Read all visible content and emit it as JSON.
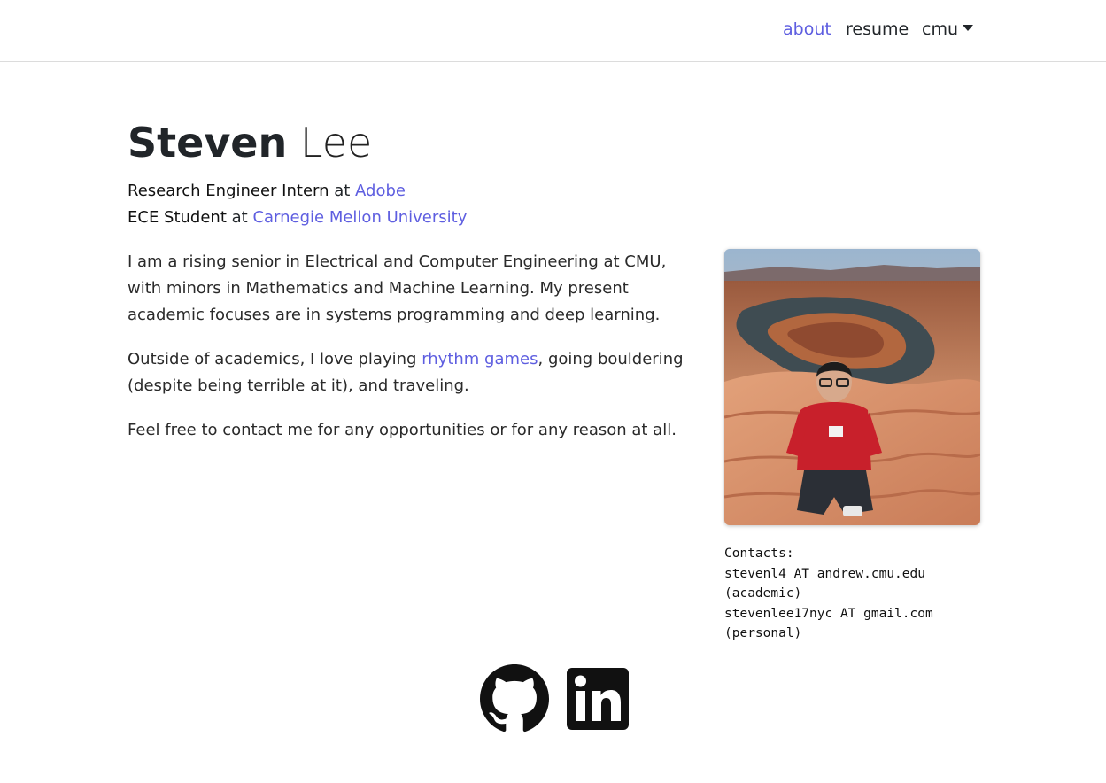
{
  "nav": {
    "items": [
      {
        "label": "about",
        "active": true
      },
      {
        "label": "resume"
      },
      {
        "label": "cmu",
        "dropdown": true
      }
    ]
  },
  "hero": {
    "first_name": "Steven",
    "last_name": " Lee",
    "roles": [
      {
        "title": "Research Engineer Intern",
        "connector": " at ",
        "org": "Adobe"
      },
      {
        "title": "ECE Student",
        "connector": " at ",
        "org": "Carnegie Mellon University"
      }
    ]
  },
  "about": {
    "p1": "I am a rising senior in Electrical and Computer Engineering at CMU, with minors in Mathematics and Machine Learning. My present academic focuses are in systems programming and deep learning.",
    "p2_before": "Outside of academics, I love playing ",
    "p2_link": "rhythm games",
    "p2_after": ", going bouldering (despite being terrible at it), and traveling.",
    "p3": "Feel free to contact me for any opportunities or for any reason at all."
  },
  "contacts": {
    "heading": "Contacts:",
    "academic": "stevenl4 AT andrew.cmu.edu",
    "academic_note": "(academic)",
    "personal": "stevenlee17nyc AT gmail.com",
    "personal_note": "(personal)"
  },
  "social": {
    "github_icon": "github-icon",
    "linkedin_icon": "linkedin-icon"
  },
  "colors": {
    "accent": "#5e5ee0",
    "text": "#212529"
  }
}
